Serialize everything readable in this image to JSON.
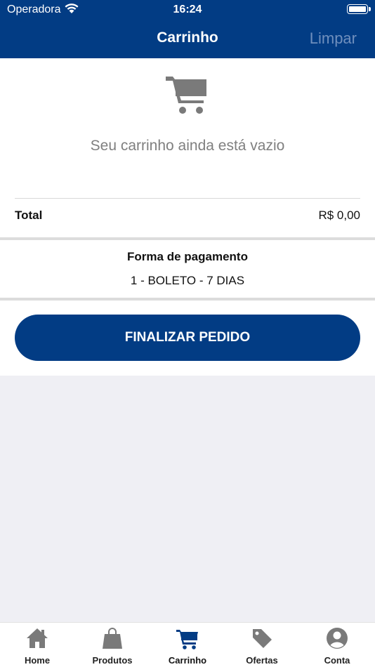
{
  "status_bar": {
    "carrier": "Operadora",
    "time": "16:24"
  },
  "navbar": {
    "title": "Carrinho",
    "clear_label": "Limpar"
  },
  "cart": {
    "empty_message": "Seu carrinho ainda está vazio",
    "total_label": "Total",
    "total_value": "R$ 0,00",
    "payment_label": "Forma de pagamento",
    "payment_value": "1 - BOLETO - 7 DIAS",
    "finish_label": "FINALIZAR PEDIDO"
  },
  "tabs": [
    {
      "label": "Home",
      "icon": "home-icon"
    },
    {
      "label": "Produtos",
      "icon": "shopping-bag-icon"
    },
    {
      "label": "Carrinho",
      "icon": "cart-icon",
      "active": true
    },
    {
      "label": "Ofertas",
      "icon": "tag-icon"
    },
    {
      "label": "Conta",
      "icon": "user-icon"
    }
  ],
  "colors": {
    "primary": "#023c84",
    "icon_gray": "#7a7a7a",
    "background": "#efeff4"
  }
}
